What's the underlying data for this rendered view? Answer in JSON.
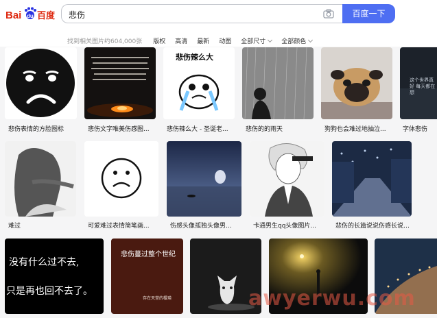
{
  "header": {
    "logo_text_left": "Bai",
    "logo_text_du": "du",
    "logo_text_cn": "百度",
    "search_value": "悲伤",
    "search_button_label": "百度一下"
  },
  "filters": {
    "result_count": "找到相关图片约604,000张",
    "items": [
      "版权",
      "高清",
      "最新",
      "动图",
      "全部尺寸",
      "全部颜色"
    ]
  },
  "row1": [
    {
      "caption": "悲伤表情的方脸图标"
    },
    {
      "caption": "悲伤文字唯美伤感图..."
    },
    {
      "caption": "悲伤辣么大 - 圣诞老...",
      "overlay": "悲伤辣么大"
    },
    {
      "caption": "悲伤的的雨天"
    },
    {
      "caption": "狗狗也会难过地抽泣..."
    },
    {
      "caption": "字体悲伤",
      "overlay": "这个世界真好 每天都在想"
    }
  ],
  "row2": [
    {
      "caption": "难过"
    },
    {
      "caption": "可爱难过表情简笔画..."
    },
    {
      "caption": "伤感头像孤独头像男..."
    },
    {
      "caption": "卡通男生qq头像图片..."
    },
    {
      "caption": "悲伤的长篇说说伤感长说说看..."
    }
  ],
  "row3": [
    {
      "overlay_line1": "没有什么过不去,",
      "overlay_line2": "只是再也回不去了。"
    },
    {
      "overlay_title": "悲伤蔓过整个世纪",
      "overlay_sub": "存在天堂的樱瑛"
    },
    {},
    {},
    {}
  ],
  "watermark": "awyerwu.com"
}
